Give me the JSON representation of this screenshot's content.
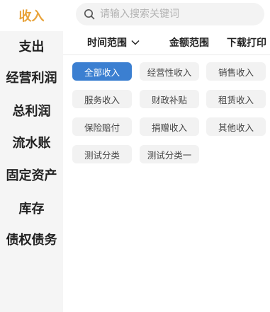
{
  "sidebar": {
    "items": [
      {
        "label": "收入"
      },
      {
        "label": "支出"
      },
      {
        "label": "经营利润"
      },
      {
        "label": "总利润"
      },
      {
        "label": "流水账"
      },
      {
        "label": "固定资产"
      },
      {
        "label": "库存"
      },
      {
        "label": "债权债务"
      }
    ]
  },
  "search": {
    "placeholder": "请输入搜索关键词",
    "value": ""
  },
  "filters": {
    "time_range": "时间范围",
    "amount_range": "金额范围",
    "download_print": "下载打印"
  },
  "categories": [
    {
      "label": "全部收入"
    },
    {
      "label": "经营性收入"
    },
    {
      "label": "销售收入"
    },
    {
      "label": "服务收入"
    },
    {
      "label": "财政补贴"
    },
    {
      "label": "租赁收入"
    },
    {
      "label": "保险赔付"
    },
    {
      "label": "捐赠收入"
    },
    {
      "label": "其他收入"
    },
    {
      "label": "测试分类"
    },
    {
      "label": "测试分类一"
    }
  ],
  "colors": {
    "accent": "#e8a33a",
    "selected": "#3b7fd1",
    "sidebar_bg": "#f5f5f5"
  },
  "icons": {
    "search": "search-icon",
    "chevron": "chevron-down-icon"
  }
}
